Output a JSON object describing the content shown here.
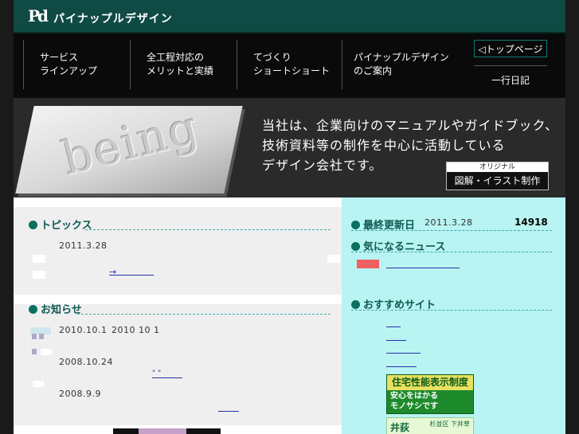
{
  "header": {
    "logo": "Pd",
    "site_name": "パイナップルデザイン"
  },
  "nav": {
    "items": [
      {
        "line1": "サービス",
        "line2": "ラインアップ"
      },
      {
        "line1": "全工程対応の",
        "line2": "メリットと実績"
      },
      {
        "line1": "てづくり",
        "line2": "ショートショート"
      },
      {
        "line1": "パイナップルデザイン",
        "line2": "のご案内"
      }
    ],
    "top_page": "◁トップページ",
    "diary": "一行日記"
  },
  "hero": {
    "word": "being",
    "lines": [
      "当社は、企業向けのマニュアルやガイドブック、",
      "技術資料等の制作を中心に活動している",
      "デザイン会社です。"
    ],
    "badge_small": "オリジナル",
    "badge_main": "図解・イラスト制作"
  },
  "topics": {
    "title": "トピックス",
    "date": "2011.3.28",
    "link": "→"
  },
  "notices": {
    "title": "お知らせ",
    "items": [
      {
        "date": "2010.10.1",
        "extra": "2010 10 1"
      },
      {
        "date": "2008.10.24"
      },
      {
        "date": "2008.9.9"
      }
    ],
    "link_b": "\"      \""
  },
  "right": {
    "updated_label": "最終更新日",
    "updated_date": "2011.3.28",
    "counter": "14918",
    "news_title": "気になるニュース",
    "sites_title": "おすすめサイト"
  },
  "banners": {
    "b1_top": "住宅性能表示制度",
    "b1_line1": "安心をはかる",
    "b1_line2": "モノサシです",
    "b2_main": "井荻",
    "b2_sub": "杉並区 下井草"
  },
  "colors": {
    "header": "#0f4a44",
    "accent": "#0a7060",
    "right_bg": "#b8f4f2",
    "left_bg": "#efefef"
  }
}
